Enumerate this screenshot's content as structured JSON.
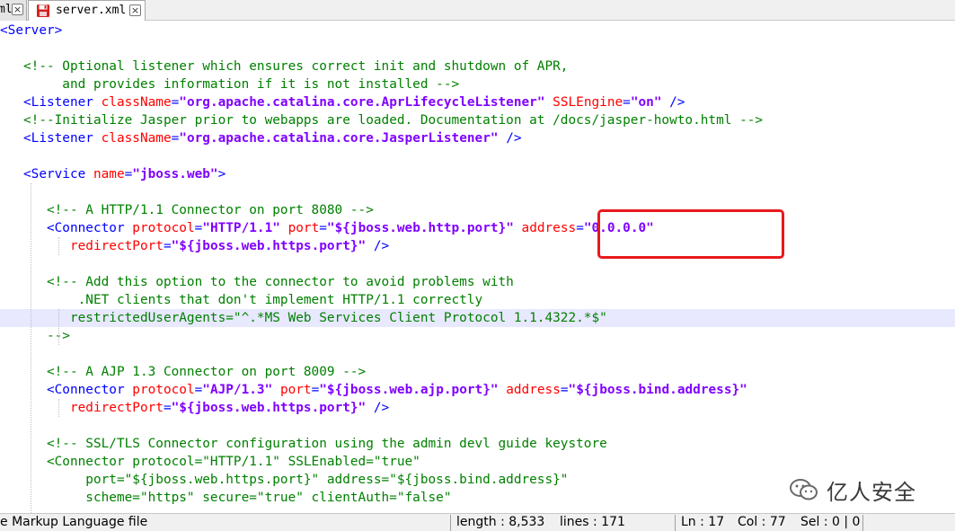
{
  "tabs": [
    {
      "label": "ml",
      "active": false
    },
    {
      "label": "server.xml",
      "active": true
    }
  ],
  "editor": {
    "lines": [
      [
        [
          "t",
          "<Server>"
        ]
      ],
      [],
      [
        [
          "c",
          "   <!-- Optional listener which ensures correct init and shutdown of APR,"
        ]
      ],
      [
        [
          "c",
          "        and provides information if it is not installed -->"
        ]
      ],
      [
        [
          "t",
          "   <Listener "
        ],
        [
          "a",
          "className"
        ],
        [
          "t",
          "="
        ],
        [
          "v",
          "\"org.apache.catalina.core.AprLifecycleListener\""
        ],
        [
          "t",
          " "
        ],
        [
          "a",
          "SSLEngine"
        ],
        [
          "t",
          "="
        ],
        [
          "v",
          "\"on\""
        ],
        [
          "t",
          " />"
        ]
      ],
      [
        [
          "c",
          "   <!--Initialize Jasper prior to webapps are loaded. Documentation at /docs/jasper-howto.html -->"
        ]
      ],
      [
        [
          "t",
          "   <Listener "
        ],
        [
          "a",
          "className"
        ],
        [
          "t",
          "="
        ],
        [
          "v",
          "\"org.apache.catalina.core.JasperListener\""
        ],
        [
          "t",
          " />"
        ]
      ],
      [],
      [
        [
          "t",
          "   <Service "
        ],
        [
          "a",
          "name"
        ],
        [
          "t",
          "="
        ],
        [
          "v",
          "\"jboss.web\""
        ],
        [
          "t",
          ">"
        ]
      ],
      [],
      [
        [
          "c",
          "      <!-- A HTTP/1.1 Connector on port 8080 -->"
        ]
      ],
      [
        [
          "t",
          "      <Connector "
        ],
        [
          "a",
          "protocol"
        ],
        [
          "t",
          "="
        ],
        [
          "v",
          "\"HTTP/1.1\""
        ],
        [
          "t",
          " "
        ],
        [
          "a",
          "port"
        ],
        [
          "t",
          "="
        ],
        [
          "v",
          "\"${jboss.web.http.port}\""
        ],
        [
          "t",
          " "
        ],
        [
          "a",
          "address"
        ],
        [
          "t",
          "="
        ],
        [
          "v",
          "\"0.0.0.0\""
        ]
      ],
      [
        [
          "t",
          "         "
        ],
        [
          "a",
          "redirectPort"
        ],
        [
          "t",
          "="
        ],
        [
          "v",
          "\"${jboss.web.https.port}\""
        ],
        [
          "t",
          " />"
        ]
      ],
      [],
      [
        [
          "c",
          "      <!-- Add this option to the connector to avoid problems with"
        ]
      ],
      [
        [
          "c",
          "          .NET clients that don't implement HTTP/1.1 correctly"
        ]
      ],
      [
        [
          "c",
          "         restrictedUserAgents=\"^.*MS Web Services Client Protocol 1.1.4322.*$\""
        ]
      ],
      [
        [
          "c",
          "      -->"
        ]
      ],
      [],
      [
        [
          "c",
          "      <!-- A AJP 1.3 Connector on port 8009 -->"
        ]
      ],
      [
        [
          "t",
          "      <Connector "
        ],
        [
          "a",
          "protocol"
        ],
        [
          "t",
          "="
        ],
        [
          "v",
          "\"AJP/1.3\""
        ],
        [
          "t",
          " "
        ],
        [
          "a",
          "port"
        ],
        [
          "t",
          "="
        ],
        [
          "v",
          "\"${jboss.web.ajp.port}\""
        ],
        [
          "t",
          " "
        ],
        [
          "a",
          "address"
        ],
        [
          "t",
          "="
        ],
        [
          "v",
          "\"${jboss.bind.address}\""
        ]
      ],
      [
        [
          "t",
          "         "
        ],
        [
          "a",
          "redirectPort"
        ],
        [
          "t",
          "="
        ],
        [
          "v",
          "\"${jboss.web.https.port}\""
        ],
        [
          "t",
          " />"
        ]
      ],
      [],
      [
        [
          "c",
          "      <!-- SSL/TLS Connector configuration using the admin devl guide keystore"
        ]
      ],
      [
        [
          "c",
          "      <Connector protocol=\"HTTP/1.1\" SSLEnabled=\"true\""
        ]
      ],
      [
        [
          "c",
          "           port=\"${jboss.web.https.port}\" address=\"${jboss.bind.address}\""
        ]
      ],
      [
        [
          "c",
          "           scheme=\"https\" secure=\"true\" clientAuth=\"false\""
        ]
      ]
    ],
    "highlighted_line": 16
  },
  "watermark": {
    "text": "亿人安全"
  },
  "status": {
    "file_type": "e Markup Language file",
    "length": "length : 8,533",
    "lines": "lines : 171",
    "ln": "Ln : 17",
    "col": "Col : 77",
    "sel": "Sel : 0 | 0"
  },
  "colors": {
    "tag": "#0000ff",
    "attribute": "#ff0000",
    "value": "#8000ff",
    "comment": "#008000",
    "highlight_box": "#e8191b",
    "current_line": "#e8e8ff"
  }
}
